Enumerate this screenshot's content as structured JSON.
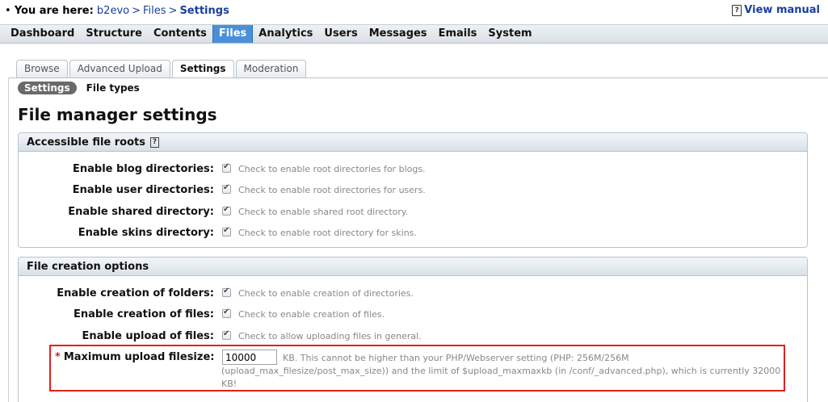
{
  "breadcrumb": {
    "prefix": "You are here:",
    "items": [
      "b2evo",
      "Files"
    ],
    "separator": ">",
    "current": "Settings"
  },
  "view_manual": "View manual",
  "main_menu": [
    {
      "label": "Dashboard",
      "active": false
    },
    {
      "label": "Structure",
      "active": false
    },
    {
      "label": "Contents",
      "active": false
    },
    {
      "label": "Files",
      "active": true
    },
    {
      "label": "Analytics",
      "active": false
    },
    {
      "label": "Users",
      "active": false
    },
    {
      "label": "Messages",
      "active": false
    },
    {
      "label": "Emails",
      "active": false
    },
    {
      "label": "System",
      "active": false
    }
  ],
  "tabs": [
    {
      "label": "Browse",
      "active": false
    },
    {
      "label": "Advanced Upload",
      "active": false
    },
    {
      "label": "Settings",
      "active": true
    },
    {
      "label": "Moderation",
      "active": false
    }
  ],
  "subtabs": {
    "active": "Settings",
    "other": "File types"
  },
  "page_title": "File manager settings",
  "roots": {
    "legend": "Accessible file roots",
    "rows": [
      {
        "label": "Enable blog directories:",
        "note": "Check to enable root directories for blogs.",
        "checked": true
      },
      {
        "label": "Enable user directories:",
        "note": "Check to enable root directories for users.",
        "checked": true
      },
      {
        "label": "Enable shared directory:",
        "note": "Check to enable shared root directory.",
        "checked": true
      },
      {
        "label": "Enable skins directory:",
        "note": "Check to enable root directory for skins.",
        "checked": true
      }
    ]
  },
  "creation": {
    "legend": "File creation options",
    "rows": [
      {
        "label": "Enable creation of folders:",
        "note": "Check to enable creation of directories.",
        "checked": true
      },
      {
        "label": "Enable creation of files:",
        "note": "Check to enable creation of files.",
        "checked": true
      },
      {
        "label": "Enable upload of files:",
        "note": "Check to allow uploading files in general.",
        "checked": true
      }
    ],
    "max_upload": {
      "required_mark": "*",
      "label": "Maximum upload filesize:",
      "value": "10000",
      "note": "KB. This cannot be higher than your PHP/Webserver setting (PHP: 256M/256M (upload_max_filesize/post_max_size)) and the limit of $upload_maxmaxkb (in /conf/_advanced.php), which is currently 32000 KB!"
    }
  },
  "colors": {
    "accent": "#4a90d9",
    "link": "#1a3e9e",
    "required": "#d42020",
    "highlight_box": "#e02020"
  }
}
